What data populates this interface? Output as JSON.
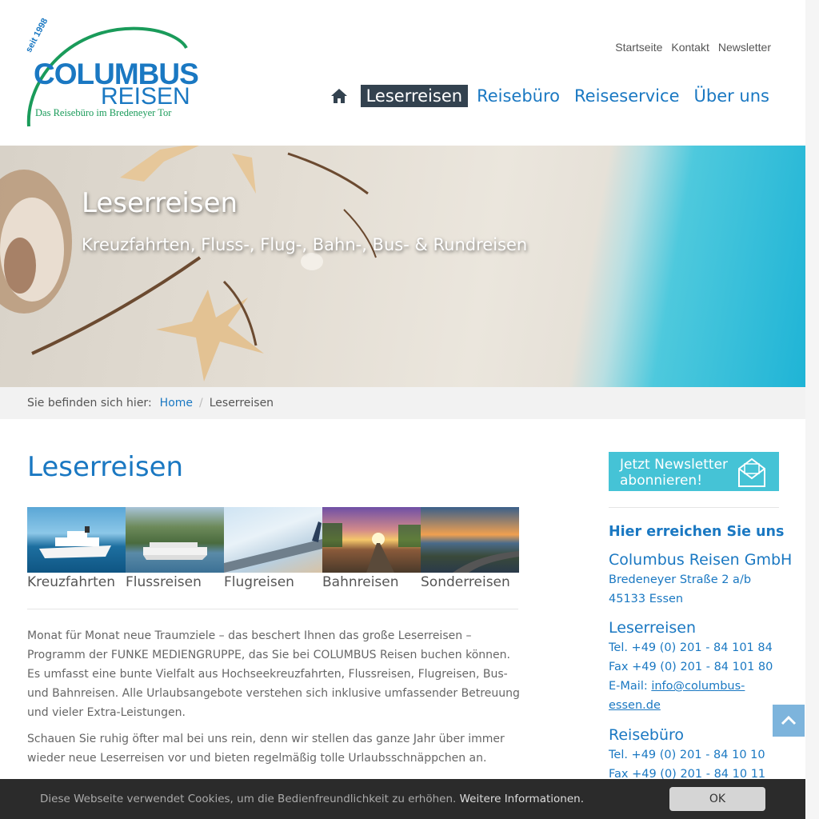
{
  "logo": {
    "seit": "seit 1998",
    "main": "COLUMBUS",
    "sub": "REISEN",
    "tagline": "Das Reisebüro im Bredeneyer Tor"
  },
  "topnav": [
    "Startseite",
    "Kontakt",
    "Newsletter"
  ],
  "mainnav": {
    "home_icon": "home-icon",
    "items": [
      {
        "label": "Leserreisen",
        "active": true
      },
      {
        "label": "Reisebüro",
        "active": false
      },
      {
        "label": "Reiseservice",
        "active": false
      },
      {
        "label": "Über uns",
        "active": false
      }
    ]
  },
  "hero": {
    "title": "Leserreisen",
    "subtitle": "Kreuzfahrten, Fluss-, Flug-, Bahn-, Bus- & Rundreisen"
  },
  "breadcrumb": {
    "prefix": "Sie befinden sich hier:",
    "home": "Home",
    "current": "Leserreisen"
  },
  "main": {
    "title": "Leserreisen",
    "tiles": [
      {
        "label": "Kreuzfahrten"
      },
      {
        "label": "Flussreisen"
      },
      {
        "label": "Flugreisen"
      },
      {
        "label": "Bahnreisen"
      },
      {
        "label": "Sonderreisen"
      }
    ],
    "paragraph1": "Monat für Monat neue Traumziele – das beschert Ihnen das große Leserreisen – Programm der FUNKE MEDIENGRUPPE, das Sie bei COLUMBUS Reisen buchen können. Es umfasst eine bunte Vielfalt aus Hochseekreuzfahrten, Flussreisen, Flugreisen, Bus- und Bahnreisen. Alle Urlaubsangebote verstehen sich inklusive umfassender Betreuung und vieler Extra-Leistungen.",
    "paragraph2": "Schauen Sie ruhig öfter mal bei uns rein, denn wir stellen das ganze Jahr über immer wieder neue Leserreisen vor und bieten regelmäßig tolle Urlaubsschnäppchen an."
  },
  "sidebar": {
    "newsletter_line1": "Jetzt Newsletter",
    "newsletter_line2": "abonnieren!",
    "heading": "Hier erreichen Sie uns",
    "company": "Columbus Reisen GmbH",
    "street": "Bredeneyer Straße 2 a/b",
    "city": "45133 Essen",
    "leserreisen_title": "Leserreisen",
    "leserreisen_tel": "Tel. +49 (0) 201 - 84 101 84",
    "leserreisen_fax": "Fax +49 (0) 201 - 84 101 80",
    "email_prefix": "E-Mail: ",
    "email_part1": "info@columbus-",
    "email_part2": "essen.de",
    "reisebuero_title": "Reisebüro",
    "reisebuero_tel": "Tel. +49 (0) 201 - 84 10 10",
    "reisebuero_fax": "Fax +49 (0) 201 - 84 10 11"
  },
  "cookie": {
    "text": "Diese Webseite verwendet Cookies, um die Bedienfreundlichkeit zu erhöhen. ",
    "more": "Weitere Informationen.",
    "ok": "OK"
  },
  "colors": {
    "brand_blue": "#1a78c2",
    "nav_active_bg": "#33424f",
    "newsletter_bg": "#45c3d6",
    "logo_green": "#1a9b5a"
  }
}
